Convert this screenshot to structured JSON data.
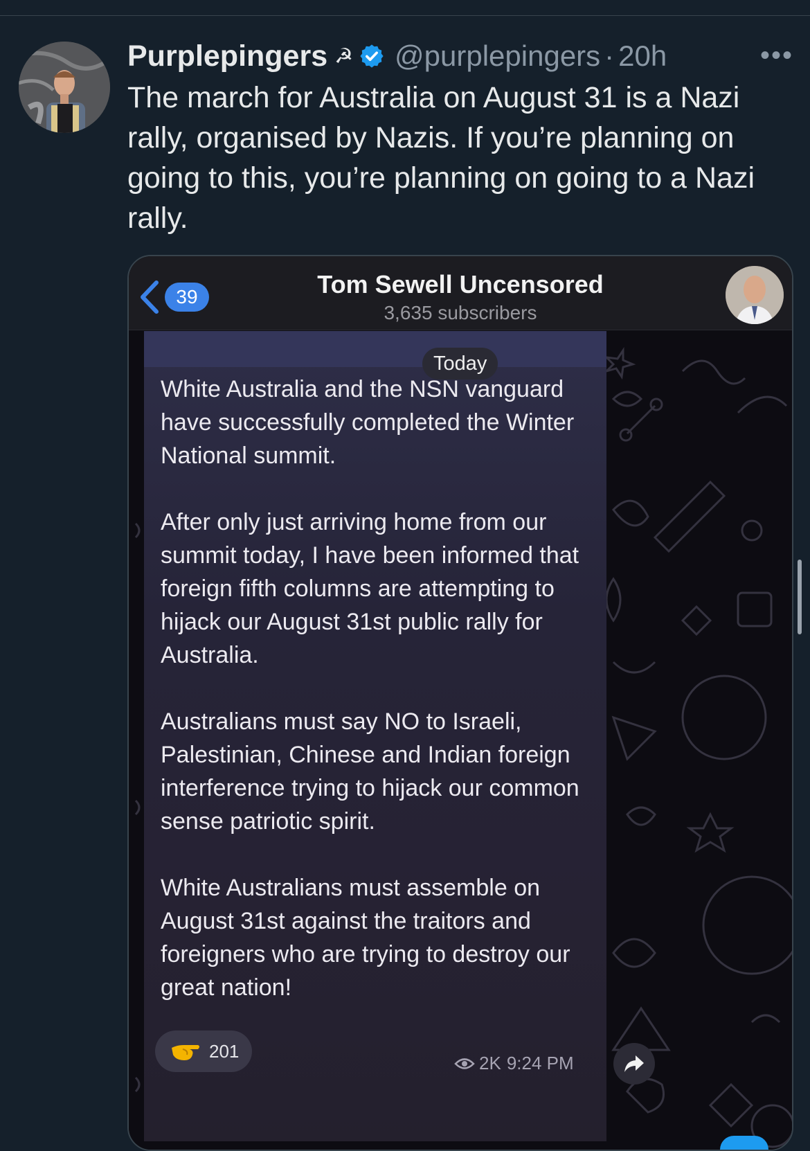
{
  "tweet": {
    "author_name": "Purplepingers",
    "flag_emoji": "☭",
    "handle": "@purplepingers",
    "separator": "·",
    "time": "20h",
    "more_label": "•••",
    "text": "The march for Australia on August 31 is a Nazi rally, organised by Nazis. If you’re planning on going to this, you’re planning on going to a Nazi rally.",
    "verified_color": "#1d9bf0"
  },
  "telegram": {
    "back_count": "39",
    "channel_title": "Tom Sewell Uncensored",
    "subscribers": "3,635 subscribers",
    "date_pill": "Today",
    "message": "White Australia and the NSN vanguard have successfully completed the Winter National summit.\n\nAfter only just arriving home from our summit today, I have been informed that foreign fifth columns are attempting to hijack our August 31st public rally for Australia.\n\nAustralians must say NO to Israeli, Palestinian, Chinese and Indian foreign interference trying to hijack our common sense patriotic spirit.\n\nWhite Australians must assemble on August 31st against the traitors and foreigners who are trying to destroy our great nation!",
    "reaction_count": "201",
    "views": "2K",
    "time": "9:24 PM",
    "accent_color": "#3b82e8"
  }
}
